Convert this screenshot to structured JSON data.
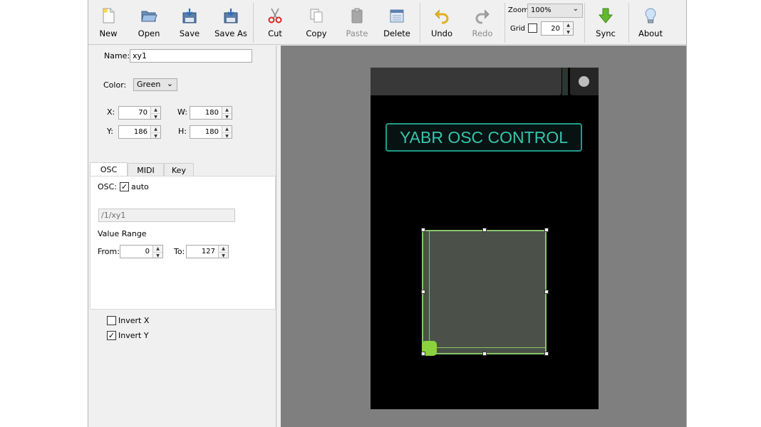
{
  "toolbar": {
    "new": "New",
    "open": "Open",
    "save": "Save",
    "save_as": "Save As",
    "cut": "Cut",
    "copy": "Copy",
    "paste": "Paste",
    "delete": "Delete",
    "undo": "Undo",
    "redo": "Redo",
    "zoom_label": "Zoom",
    "zoom_value": "100%",
    "grid_label": "Grid",
    "grid_checked": false,
    "grid_value": "20",
    "sync": "Sync",
    "about": "About"
  },
  "properties": {
    "name_label": "Name:",
    "name_value": "xy1",
    "color_label": "Color:",
    "color_value": "Green",
    "x_label": "X:",
    "x_value": "70",
    "w_label": "W:",
    "w_value": "180",
    "y_label": "Y:",
    "y_value": "186",
    "h_label": "H:",
    "h_value": "180"
  },
  "tabs": [
    "OSC",
    "MIDI",
    "Key"
  ],
  "osc": {
    "osc_label": "OSC:",
    "auto_label": "auto",
    "auto_checked": true,
    "address": "/1/xy1",
    "value_range_label": "Value Range",
    "from_label": "From:",
    "from_value": "0",
    "to_label": "To:",
    "to_value": "127"
  },
  "options": {
    "invert_x_label": "Invert X",
    "invert_x_checked": false,
    "invert_y_label": "Invert Y",
    "invert_y_checked": true
  },
  "canvas": {
    "title_label": "YABR OSC CONTROL",
    "title_color": "#36c5ae",
    "pad_color": "#88c46c"
  }
}
